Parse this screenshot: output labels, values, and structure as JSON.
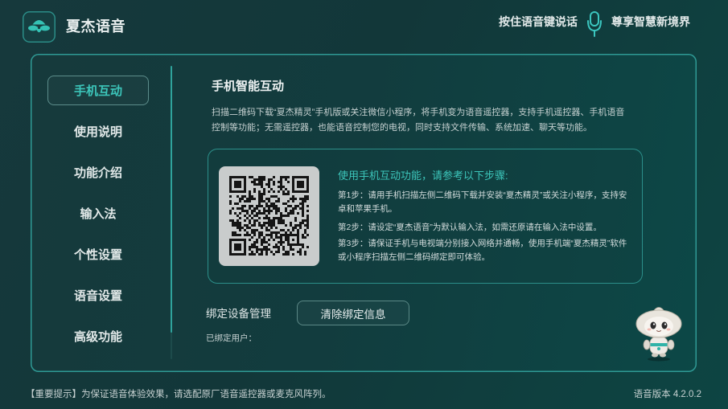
{
  "header": {
    "app_title": "夏杰语音",
    "hint": "按住语音键说话",
    "slogan": "尊享智慧新境界"
  },
  "icons": {
    "logo": "app-logo-icon",
    "microphone": "microphone-icon",
    "mascot": "robot-mascot",
    "qr": "qr-code"
  },
  "colors": {
    "accent": "#3cc5ba",
    "text": "#e4ebeb",
    "panel_border": "#2f9a95",
    "qr_background": "#c9cccc"
  },
  "sidebar": {
    "selected_index": 0,
    "scroll_thumb_fraction": 0.91,
    "items": [
      {
        "label": "手机互动"
      },
      {
        "label": "使用说明"
      },
      {
        "label": "功能介绍"
      },
      {
        "label": "输入法"
      },
      {
        "label": "个性设置"
      },
      {
        "label": "语音设置"
      },
      {
        "label": "高级功能"
      }
    ]
  },
  "content": {
    "title": "手机智能互动",
    "description_lines": [
      "扫描二维码下载“夏杰精灵”手机版或关注微信小程序，将手机变为语音遥控器，支持手机遥控器、手机语音",
      "控制等功能；无需遥控器，也能语音控制您的电视，同时支持文件传输、系统加速、聊天等功能。"
    ],
    "guide": {
      "heading": "使用手机互动功能，请参考以下步骤:",
      "steps": [
        {
          "lines": [
            "第1步：请用手机扫描左侧二维码下载并安装“夏杰精灵”或关注小程序，支持安",
            "卓和苹果手机。"
          ]
        },
        {
          "lines": [
            "第2步：请设定“夏杰语音”为默认输入法，如需还原请在输入法中设置。"
          ]
        },
        {
          "lines": [
            "第3步：请保证手机与电视端分别接入网络并通畅，使用手机端“夏杰精灵”软件",
            "或小程序扫描左侧二维码绑定即可体验。"
          ]
        }
      ]
    },
    "binding": {
      "label": "绑定设备管理",
      "clear_button": "清除绑定信息",
      "bound_users_label": "已绑定用户："
    }
  },
  "footer": {
    "notice": "【重要提示】为保证语音体验效果，请选配原厂语音遥控器或麦克风阵列。",
    "version": "语音版本 4.2.0.2"
  }
}
